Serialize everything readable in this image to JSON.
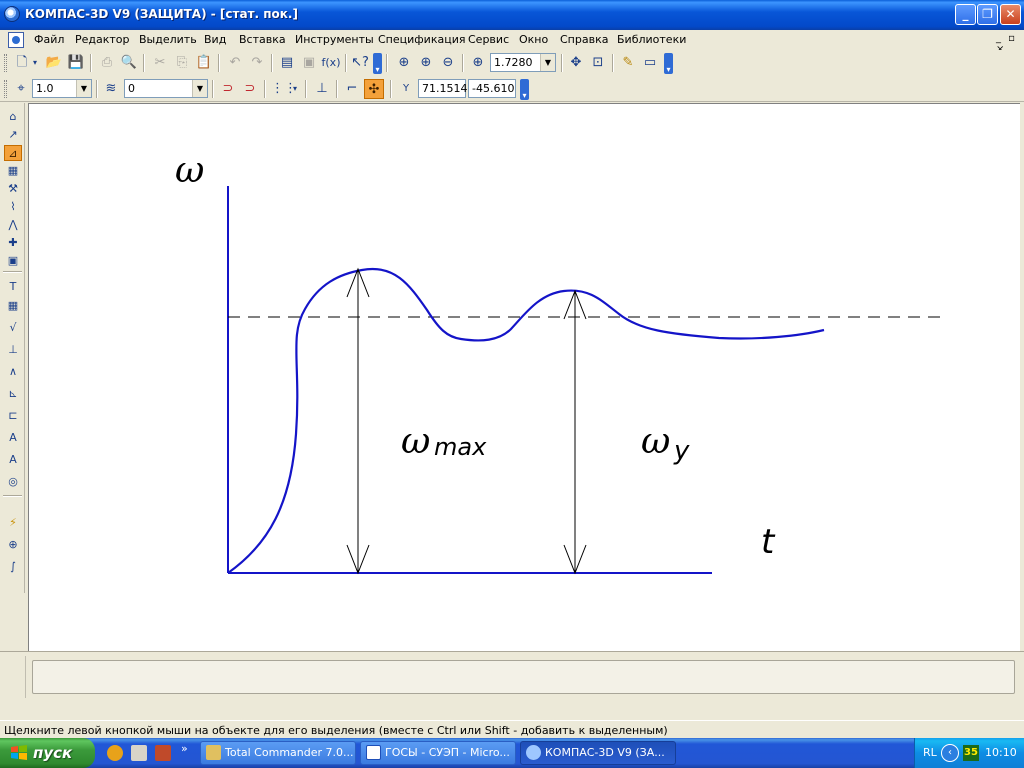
{
  "window": {
    "title": "КОМПАС-3D V9 (ЗАЩИТА) - [стат. пок.]",
    "controls": {
      "minimize": "_",
      "restore": "❐",
      "close": "✕"
    }
  },
  "menu": {
    "items": [
      "Файл",
      "Редактор",
      "Выделить",
      "Вид",
      "Вставка",
      "Инструменты",
      "Спецификация",
      "Сервис",
      "Окно",
      "Справка",
      "Библиотеки"
    ],
    "right_controls": "_ ▫ ×"
  },
  "toolbar1": {
    "zoom_value": "1.7280",
    "fx_label": "f(x)"
  },
  "toolbar2": {
    "scale_value": "1.0",
    "layer_value": "0",
    "coord_label": "Y",
    "coord_x": "71.1514",
    "coord_y": "-45.610"
  },
  "drawing": {
    "y_axis_symbol": "ω",
    "x_axis_symbol": "t",
    "label_max_symbol": "ω",
    "label_max_sub": "max",
    "label_steady_symbol": "ω",
    "label_steady_sub": "y",
    "colors": {
      "curve": "#1414c8",
      "axes": "#1414c8",
      "lines": "#000000"
    }
  },
  "status": {
    "text": "Щелкните левой кнопкой мыши на объекте для его выделения (вместе с Ctrl или Shift - добавить к выделенным)"
  },
  "taskbar": {
    "start_label": "пуск",
    "quick_launch_more": "»",
    "tasks": [
      {
        "label": "Total Commander 7.0...",
        "active": false
      },
      {
        "label": "ГОСЫ - СУЭП - Micro...",
        "active": false
      },
      {
        "label": "КОМПАС-3D V9 (ЗА...",
        "active": true
      }
    ],
    "tray": {
      "lang": "RL",
      "icon_text": "35",
      "clock": "10:10"
    }
  }
}
